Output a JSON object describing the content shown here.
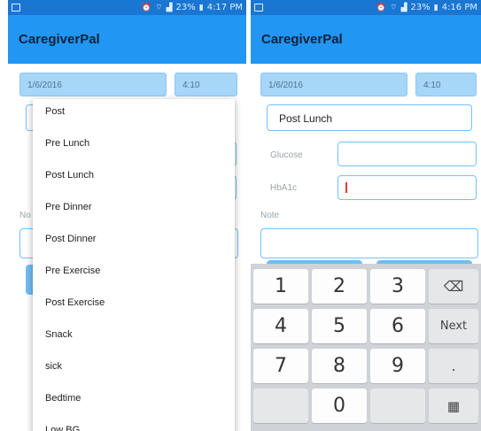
{
  "left": {
    "status_time": "4:17 PM",
    "status_battery": "23%",
    "app_title": "CaregiverPal",
    "date": "1/6/2016",
    "time": "4:10",
    "hidden_label_partial": "No",
    "dropdown_items": [
      "Post",
      "Pre Lunch",
      "Post Lunch",
      "Pre Dinner",
      "Post Dinner",
      "Pre Exercise",
      "Post Exercise",
      "Snack",
      "sick",
      "Bedtime",
      "Low BG"
    ]
  },
  "right": {
    "status_time": "4:16 PM",
    "status_battery": "23%",
    "app_title": "CaregiverPal",
    "date": "1/6/2016",
    "time": "4:10",
    "meal_value": "Post Lunch",
    "glucose_label": "Glucose",
    "hba1c_label": "HbA1c",
    "note_label": "Note",
    "keyboard": {
      "row1": [
        "1",
        "2",
        "3"
      ],
      "row2": [
        "4",
        "5",
        "6"
      ],
      "row3": [
        "7",
        "8",
        "9"
      ],
      "row4_mid": "0",
      "next_label": "Next",
      "dot_label": ".",
      "backspace_icon": "⌫",
      "emoji_icon": "▦"
    }
  },
  "colors": {
    "status_bar": "#1976d2",
    "app_bar": "#2196f3",
    "field_fill": "#a6d6f8",
    "outline": "#76c1f4",
    "keyboard_bg": "#cfd2d6"
  }
}
